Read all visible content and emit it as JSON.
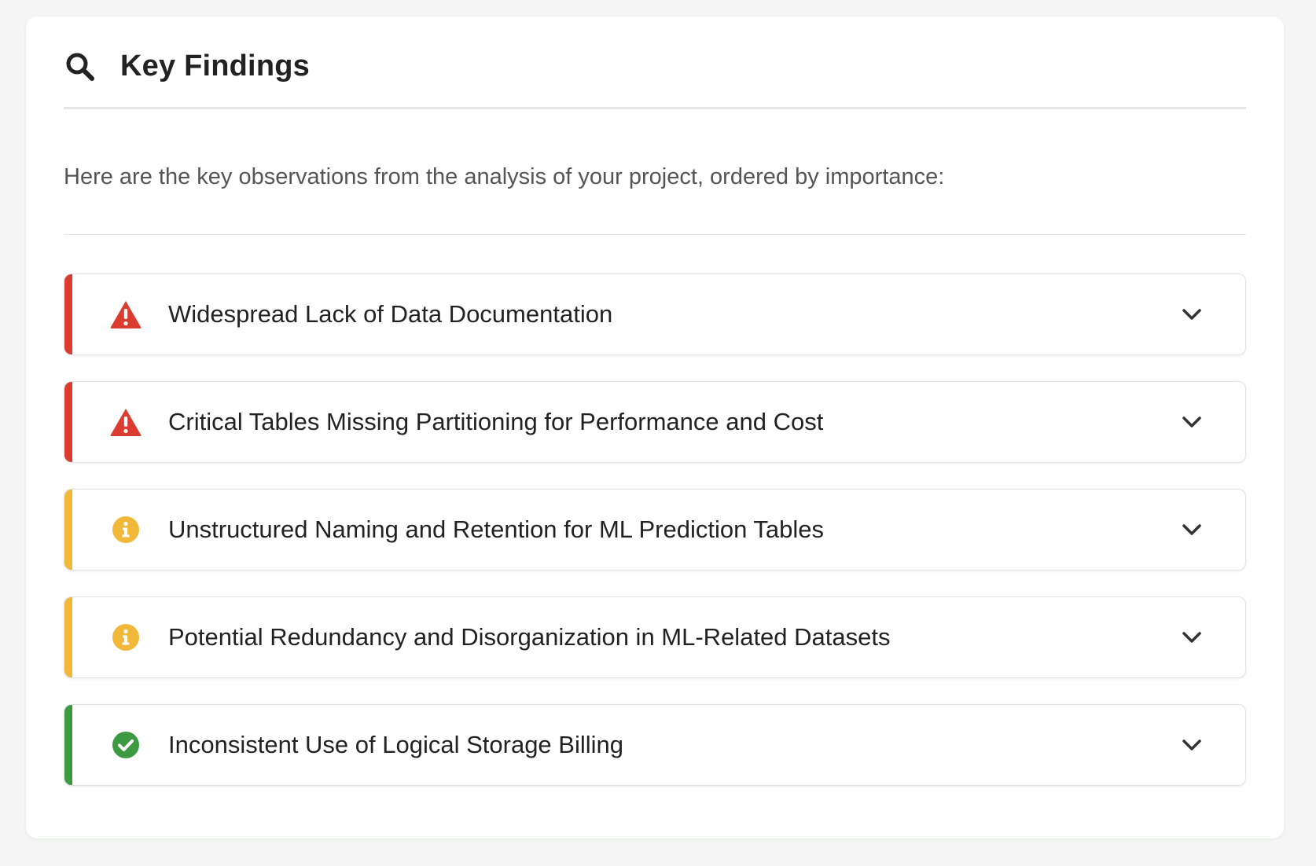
{
  "header": {
    "title": "Key Findings",
    "icon": "search-icon"
  },
  "intro": "Here are the key observations from the analysis of your project, ordered by importance:",
  "colors": {
    "critical": "#dc3c2f",
    "warning": "#f2b83a",
    "ok": "#3e9a41"
  },
  "findings": [
    {
      "title": "Widespread Lack of Data Documentation",
      "severity": "critical",
      "icon": "warning-triangle-icon"
    },
    {
      "title": "Critical Tables Missing Partitioning for Performance and Cost",
      "severity": "critical",
      "icon": "warning-triangle-icon"
    },
    {
      "title": "Unstructured Naming and Retention for ML Prediction Tables",
      "severity": "warning",
      "icon": "info-circle-icon"
    },
    {
      "title": "Potential Redundancy and Disorganization in ML-Related Datasets",
      "severity": "warning",
      "icon": "info-circle-icon"
    },
    {
      "title": "Inconsistent Use of Logical Storage Billing",
      "severity": "ok",
      "icon": "check-circle-icon"
    }
  ]
}
